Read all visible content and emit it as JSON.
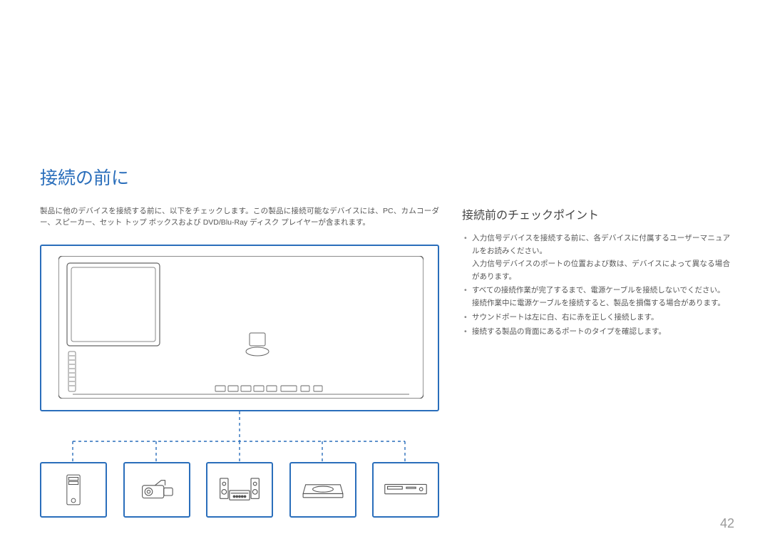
{
  "title": "接続の前に",
  "intro": "製品に他のデバイスを接続する前に、以下をチェックします。この製品に接続可能なデバイスには、PC、カムコーダー、スピーカー、セット トップ ボックスおよび DVD/Blu-Ray ディスク プレイヤーが含まれます。",
  "subheading": "接続前のチェックポイント",
  "points": [
    {
      "main": "入力信号デバイスを接続する前に、各デバイスに付属するユーザーマニュアルをお読みください。",
      "sub": "入力信号デバイスのポートの位置および数は、デバイスによって異なる場合があります。"
    },
    {
      "main": "すべての接続作業が完了するまで、電源ケーブルを接続しないでください。",
      "sub": "接続作業中に電源ケーブルを接続すると、製品を損傷する場合があります。"
    },
    {
      "main": "サウンドポートは左に白、右に赤を正しく接続します。",
      "sub": ""
    },
    {
      "main": "接続する製品の背面にあるポートのタイプを確認します。",
      "sub": ""
    }
  ],
  "devices": [
    {
      "name": "pc-tower"
    },
    {
      "name": "camcorder"
    },
    {
      "name": "speaker-system"
    },
    {
      "name": "settop-box"
    },
    {
      "name": "disc-player"
    }
  ],
  "page_number": "42"
}
